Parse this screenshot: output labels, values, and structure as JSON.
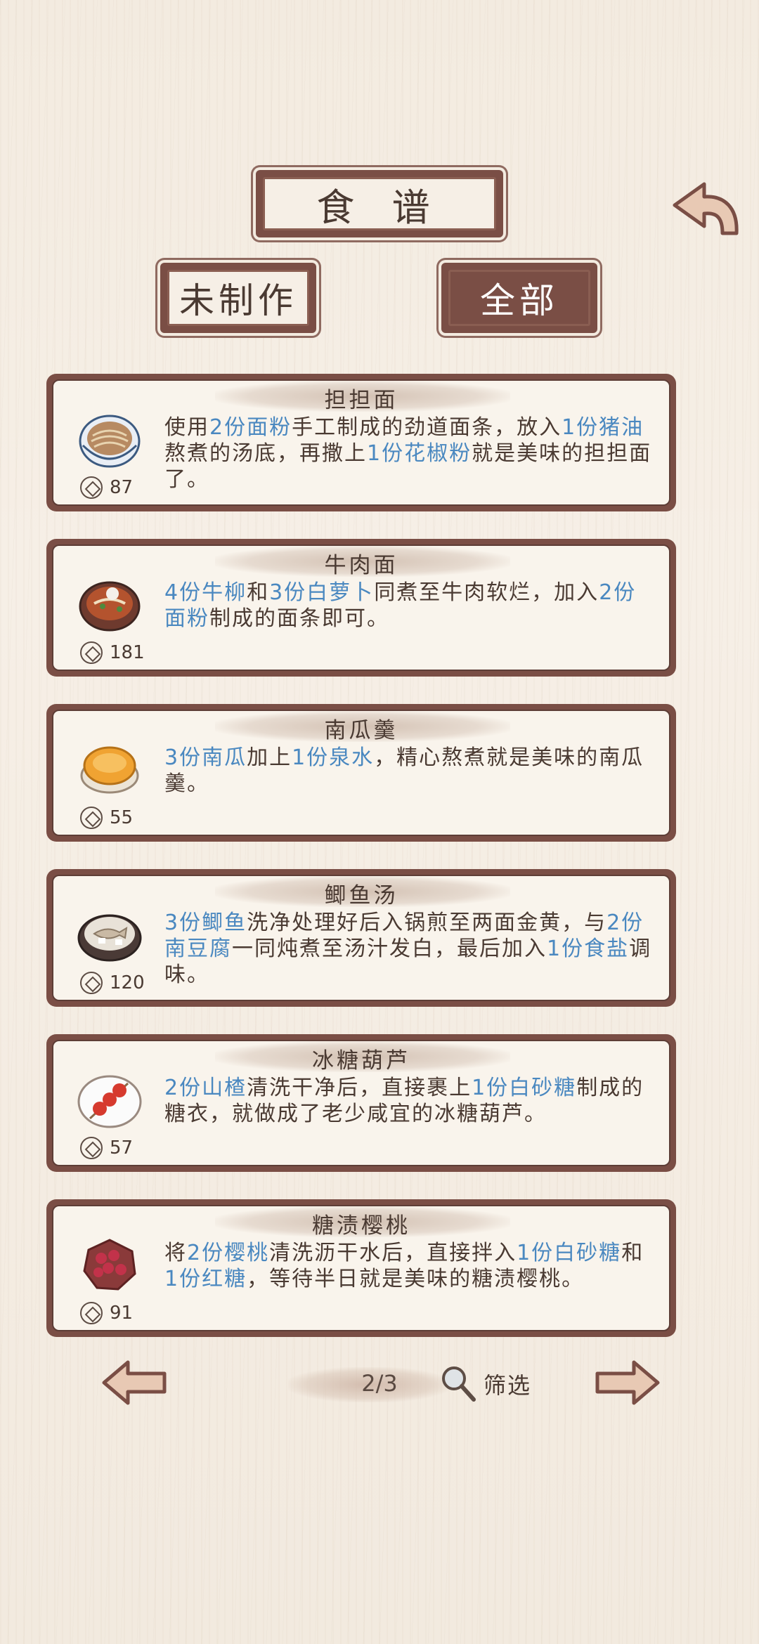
{
  "header": {
    "title": "食  谱"
  },
  "tabs": [
    {
      "label": "未制作",
      "active": false
    },
    {
      "label": "全部",
      "active": true
    }
  ],
  "recipes": [
    {
      "name": "担担面",
      "price": "87",
      "parts": [
        {
          "t": "使用"
        },
        {
          "t": "2份面粉",
          "h": 1
        },
        {
          "t": "手工制成的劲道面条，放入"
        },
        {
          "t": "1份猪油",
          "h": 1
        },
        {
          "t": "熬煮的汤底，再撒上"
        },
        {
          "t": "1份花椒粉",
          "h": 1
        },
        {
          "t": "就是美味的担担面了。"
        }
      ]
    },
    {
      "name": "牛肉面",
      "price": "181",
      "parts": [
        {
          "t": "4份牛柳",
          "h": 1
        },
        {
          "t": "和"
        },
        {
          "t": "3份白萝卜",
          "h": 1
        },
        {
          "t": "同煮至牛肉软烂，加入"
        },
        {
          "t": "2份面粉",
          "h": 1
        },
        {
          "t": "制成的面条即可。"
        }
      ]
    },
    {
      "name": "南瓜羹",
      "price": "55",
      "parts": [
        {
          "t": "3份南瓜",
          "h": 1
        },
        {
          "t": "加上"
        },
        {
          "t": "1份泉水",
          "h": 1
        },
        {
          "t": "，精心熬煮就是美味的南瓜羹。"
        }
      ]
    },
    {
      "name": "鲫鱼汤",
      "price": "120",
      "parts": [
        {
          "t": "3份鲫鱼",
          "h": 1
        },
        {
          "t": "洗净处理好后入锅煎至两面金黄，与"
        },
        {
          "t": "2份南豆腐",
          "h": 1
        },
        {
          "t": "一同炖煮至汤汁发白，最后加入"
        },
        {
          "t": "1份食盐",
          "h": 1
        },
        {
          "t": "调味。"
        }
      ]
    },
    {
      "name": "冰糖葫芦",
      "price": "57",
      "parts": [
        {
          "t": "2份山楂",
          "h": 1
        },
        {
          "t": "清洗干净后，直接裹上"
        },
        {
          "t": "1份白砂糖",
          "h": 1
        },
        {
          "t": "制成的糖衣，就做成了老少咸宜的冰糖葫芦。"
        }
      ]
    },
    {
      "name": "糖渍樱桃",
      "price": "91",
      "parts": [
        {
          "t": "将"
        },
        {
          "t": "2份樱桃",
          "h": 1
        },
        {
          "t": "清洗沥干水后，直接拌入"
        },
        {
          "t": "1份白砂糖",
          "h": 1
        },
        {
          "t": "和"
        },
        {
          "t": "1份红糖",
          "h": 1
        },
        {
          "t": "，等待半日就是美味的糖渍樱桃。"
        }
      ]
    }
  ],
  "pager": {
    "page": "2/3",
    "filter_label": "筛选"
  },
  "colors": {
    "frame": "#7a4e45",
    "paper": "#f9f4ec",
    "highlight": "#4a88c0",
    "text": "#4a3a32"
  }
}
